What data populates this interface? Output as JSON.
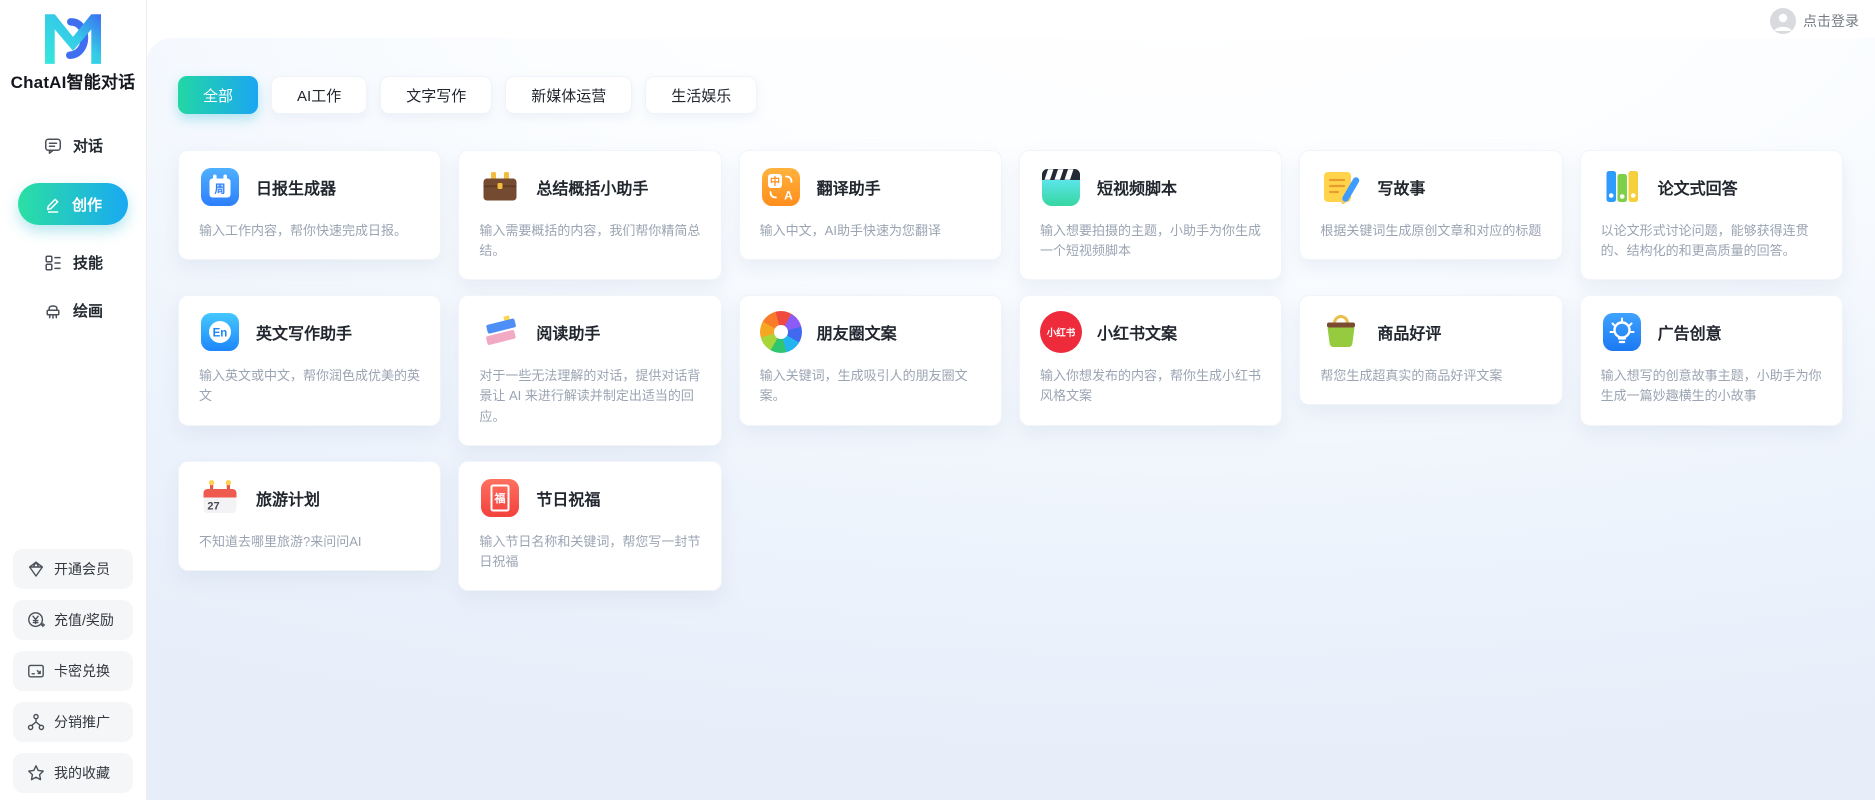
{
  "brand": {
    "title": "ChatAI智能对话",
    "logo_icon": "md-logo-icon"
  },
  "topbar": {
    "login": "点击登录",
    "avatar_icon": "avatar-icon"
  },
  "sidebar": {
    "nav": [
      {
        "label": "对话",
        "icon": "chat-bubble-icon",
        "active": false
      },
      {
        "label": "创作",
        "icon": "pencil-icon",
        "active": true
      },
      {
        "label": "技能",
        "icon": "skills-grid-icon",
        "active": false
      },
      {
        "label": "绘画",
        "icon": "paintbrush-icon",
        "active": false
      }
    ],
    "shortcuts": [
      {
        "label": "开通会员",
        "icon": "gem-icon"
      },
      {
        "label": "充值/奖励",
        "icon": "yen-coin-icon"
      },
      {
        "label": "卡密兑换",
        "icon": "card-redeem-icon"
      },
      {
        "label": "分销推广",
        "icon": "share-network-icon"
      },
      {
        "label": "我的收藏",
        "icon": "star-icon"
      }
    ]
  },
  "tabs": [
    {
      "label": "全部",
      "active": true
    },
    {
      "label": "AI工作",
      "active": false
    },
    {
      "label": "文字写作",
      "active": false
    },
    {
      "label": "新媒体运营",
      "active": false
    },
    {
      "label": "生活娱乐",
      "active": false
    }
  ],
  "cards": [
    {
      "title": "日报生成器",
      "desc": "输入工作内容，帮你快速完成日报。",
      "icon": "daily-report-icon"
    },
    {
      "title": "总结概括小助手",
      "desc": "输入需要概括的内容，我们帮你精简总结。",
      "icon": "briefcase-icon"
    },
    {
      "title": "翻译助手",
      "desc": "输入中文，AI助手快速为您翻译",
      "icon": "translate-icon"
    },
    {
      "title": "短视频脚本",
      "desc": "输入想要拍摄的主题，小助手为你生成一个短视频脚本",
      "icon": "clapperboard-icon"
    },
    {
      "title": "写故事",
      "desc": "根据关键词生成原创文章和对应的标题",
      "icon": "memo-pencil-icon"
    },
    {
      "title": "论文式回答",
      "desc": "以论文形式讨论问题，能够获得连贯的、结构化的和更高质量的回答。",
      "icon": "binders-icon"
    },
    {
      "title": "英文写作助手",
      "desc": "输入英文或中文，帮你润色成优美的英文",
      "icon": "english-badge-icon"
    },
    {
      "title": "阅读助手",
      "desc": "对于一些无法理解的对话，提供对话背景让 AI 来进行解读并制定出适当的回应。",
      "icon": "books-icon"
    },
    {
      "title": "朋友圈文案",
      "desc": "输入关键词，生成吸引人的朋友圈文案。",
      "icon": "moments-pinwheel-icon"
    },
    {
      "title": "小红书文案",
      "desc": "输入你想发布的内容，帮你生成小红书风格文案",
      "icon": "xiaohongshu-icon"
    },
    {
      "title": "商品好评",
      "desc": "帮您生成超真实的商品好评文案",
      "icon": "shopping-bag-icon"
    },
    {
      "title": "广告创意",
      "desc": "输入想写的创意故事主题，小助手为你生成一篇妙趣横生的小故事",
      "icon": "lightbulb-icon"
    },
    {
      "title": "旅游计划",
      "desc": "不知道去哪里旅游?来问问AI",
      "icon": "calendar-icon"
    },
    {
      "title": "节日祝福",
      "desc": "输入节日名称和关键词，帮您写一封节日祝福",
      "icon": "festival-icon"
    }
  ],
  "icon_text": {
    "daily_calendar": "周",
    "translate_cn": "中",
    "translate_en": "A",
    "english_badge": "En",
    "xiaohongshu_badge": "小红书",
    "travel_day": "27",
    "festival_char": "福"
  },
  "colors": {
    "accent_gradient_start": "#2BDFA2",
    "accent_gradient_end": "#19A9F2",
    "brand_blue": "#1E86FB",
    "xiaohongshu_red": "#EE2B3B",
    "panel_bg": "#EAF1FB"
  }
}
